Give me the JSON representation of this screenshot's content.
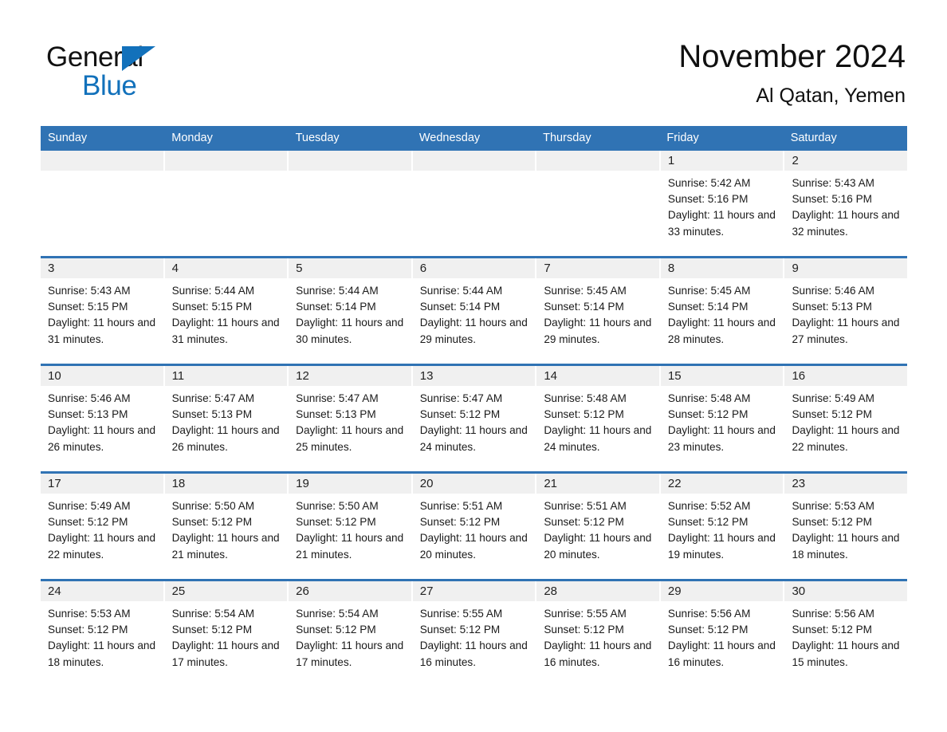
{
  "brand": {
    "name_part1": "General",
    "name_part2": "Blue",
    "triangle_color": "#1271bb",
    "logo_icon": "general-blue-logo"
  },
  "header": {
    "title": "November 2024",
    "subtitle": "Al Qatan, Yemen"
  },
  "theme": {
    "header_blue": "#3073b4",
    "daynum_band": "#f0f0f0",
    "brand_blue": "#1271bb",
    "text": "#1a1a1a"
  },
  "weekdays": [
    "Sunday",
    "Monday",
    "Tuesday",
    "Wednesday",
    "Thursday",
    "Friday",
    "Saturday"
  ],
  "weeks": [
    [
      {
        "day": "",
        "sunrise": "",
        "sunset": "",
        "daylight": "",
        "empty": true
      },
      {
        "day": "",
        "sunrise": "",
        "sunset": "",
        "daylight": "",
        "empty": true
      },
      {
        "day": "",
        "sunrise": "",
        "sunset": "",
        "daylight": "",
        "empty": true
      },
      {
        "day": "",
        "sunrise": "",
        "sunset": "",
        "daylight": "",
        "empty": true
      },
      {
        "day": "",
        "sunrise": "",
        "sunset": "",
        "daylight": "",
        "empty": true
      },
      {
        "day": "1",
        "sunrise": "Sunrise: 5:42 AM",
        "sunset": "Sunset: 5:16 PM",
        "daylight": "Daylight: 11 hours and 33 minutes.",
        "empty": false
      },
      {
        "day": "2",
        "sunrise": "Sunrise: 5:43 AM",
        "sunset": "Sunset: 5:16 PM",
        "daylight": "Daylight: 11 hours and 32 minutes.",
        "empty": false
      }
    ],
    [
      {
        "day": "3",
        "sunrise": "Sunrise: 5:43 AM",
        "sunset": "Sunset: 5:15 PM",
        "daylight": "Daylight: 11 hours and 31 minutes.",
        "empty": false
      },
      {
        "day": "4",
        "sunrise": "Sunrise: 5:44 AM",
        "sunset": "Sunset: 5:15 PM",
        "daylight": "Daylight: 11 hours and 31 minutes.",
        "empty": false
      },
      {
        "day": "5",
        "sunrise": "Sunrise: 5:44 AM",
        "sunset": "Sunset: 5:14 PM",
        "daylight": "Daylight: 11 hours and 30 minutes.",
        "empty": false
      },
      {
        "day": "6",
        "sunrise": "Sunrise: 5:44 AM",
        "sunset": "Sunset: 5:14 PM",
        "daylight": "Daylight: 11 hours and 29 minutes.",
        "empty": false
      },
      {
        "day": "7",
        "sunrise": "Sunrise: 5:45 AM",
        "sunset": "Sunset: 5:14 PM",
        "daylight": "Daylight: 11 hours and 29 minutes.",
        "empty": false
      },
      {
        "day": "8",
        "sunrise": "Sunrise: 5:45 AM",
        "sunset": "Sunset: 5:14 PM",
        "daylight": "Daylight: 11 hours and 28 minutes.",
        "empty": false
      },
      {
        "day": "9",
        "sunrise": "Sunrise: 5:46 AM",
        "sunset": "Sunset: 5:13 PM",
        "daylight": "Daylight: 11 hours and 27 minutes.",
        "empty": false
      }
    ],
    [
      {
        "day": "10",
        "sunrise": "Sunrise: 5:46 AM",
        "sunset": "Sunset: 5:13 PM",
        "daylight": "Daylight: 11 hours and 26 minutes.",
        "empty": false
      },
      {
        "day": "11",
        "sunrise": "Sunrise: 5:47 AM",
        "sunset": "Sunset: 5:13 PM",
        "daylight": "Daylight: 11 hours and 26 minutes.",
        "empty": false
      },
      {
        "day": "12",
        "sunrise": "Sunrise: 5:47 AM",
        "sunset": "Sunset: 5:13 PM",
        "daylight": "Daylight: 11 hours and 25 minutes.",
        "empty": false
      },
      {
        "day": "13",
        "sunrise": "Sunrise: 5:47 AM",
        "sunset": "Sunset: 5:12 PM",
        "daylight": "Daylight: 11 hours and 24 minutes.",
        "empty": false
      },
      {
        "day": "14",
        "sunrise": "Sunrise: 5:48 AM",
        "sunset": "Sunset: 5:12 PM",
        "daylight": "Daylight: 11 hours and 24 minutes.",
        "empty": false
      },
      {
        "day": "15",
        "sunrise": "Sunrise: 5:48 AM",
        "sunset": "Sunset: 5:12 PM",
        "daylight": "Daylight: 11 hours and 23 minutes.",
        "empty": false
      },
      {
        "day": "16",
        "sunrise": "Sunrise: 5:49 AM",
        "sunset": "Sunset: 5:12 PM",
        "daylight": "Daylight: 11 hours and 22 minutes.",
        "empty": false
      }
    ],
    [
      {
        "day": "17",
        "sunrise": "Sunrise: 5:49 AM",
        "sunset": "Sunset: 5:12 PM",
        "daylight": "Daylight: 11 hours and 22 minutes.",
        "empty": false
      },
      {
        "day": "18",
        "sunrise": "Sunrise: 5:50 AM",
        "sunset": "Sunset: 5:12 PM",
        "daylight": "Daylight: 11 hours and 21 minutes.",
        "empty": false
      },
      {
        "day": "19",
        "sunrise": "Sunrise: 5:50 AM",
        "sunset": "Sunset: 5:12 PM",
        "daylight": "Daylight: 11 hours and 21 minutes.",
        "empty": false
      },
      {
        "day": "20",
        "sunrise": "Sunrise: 5:51 AM",
        "sunset": "Sunset: 5:12 PM",
        "daylight": "Daylight: 11 hours and 20 minutes.",
        "empty": false
      },
      {
        "day": "21",
        "sunrise": "Sunrise: 5:51 AM",
        "sunset": "Sunset: 5:12 PM",
        "daylight": "Daylight: 11 hours and 20 minutes.",
        "empty": false
      },
      {
        "day": "22",
        "sunrise": "Sunrise: 5:52 AM",
        "sunset": "Sunset: 5:12 PM",
        "daylight": "Daylight: 11 hours and 19 minutes.",
        "empty": false
      },
      {
        "day": "23",
        "sunrise": "Sunrise: 5:53 AM",
        "sunset": "Sunset: 5:12 PM",
        "daylight": "Daylight: 11 hours and 18 minutes.",
        "empty": false
      }
    ],
    [
      {
        "day": "24",
        "sunrise": "Sunrise: 5:53 AM",
        "sunset": "Sunset: 5:12 PM",
        "daylight": "Daylight: 11 hours and 18 minutes.",
        "empty": false
      },
      {
        "day": "25",
        "sunrise": "Sunrise: 5:54 AM",
        "sunset": "Sunset: 5:12 PM",
        "daylight": "Daylight: 11 hours and 17 minutes.",
        "empty": false
      },
      {
        "day": "26",
        "sunrise": "Sunrise: 5:54 AM",
        "sunset": "Sunset: 5:12 PM",
        "daylight": "Daylight: 11 hours and 17 minutes.",
        "empty": false
      },
      {
        "day": "27",
        "sunrise": "Sunrise: 5:55 AM",
        "sunset": "Sunset: 5:12 PM",
        "daylight": "Daylight: 11 hours and 16 minutes.",
        "empty": false
      },
      {
        "day": "28",
        "sunrise": "Sunrise: 5:55 AM",
        "sunset": "Sunset: 5:12 PM",
        "daylight": "Daylight: 11 hours and 16 minutes.",
        "empty": false
      },
      {
        "day": "29",
        "sunrise": "Sunrise: 5:56 AM",
        "sunset": "Sunset: 5:12 PM",
        "daylight": "Daylight: 11 hours and 16 minutes.",
        "empty": false
      },
      {
        "day": "30",
        "sunrise": "Sunrise: 5:56 AM",
        "sunset": "Sunset: 5:12 PM",
        "daylight": "Daylight: 11 hours and 15 minutes.",
        "empty": false
      }
    ]
  ]
}
